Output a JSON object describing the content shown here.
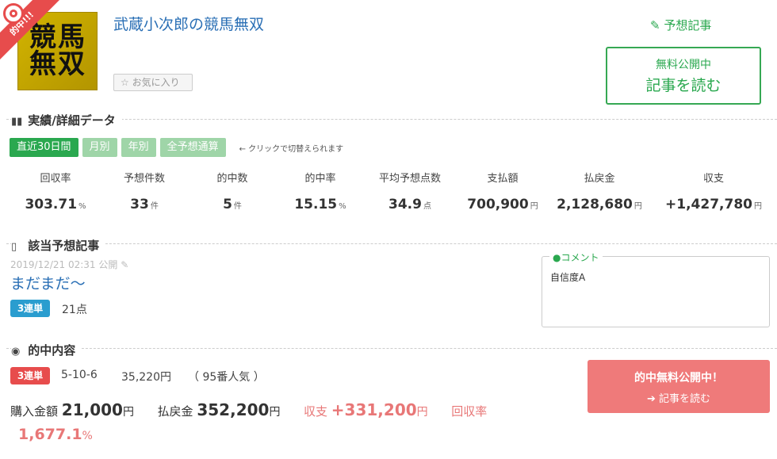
{
  "header": {
    "ribbon": "的中!!!",
    "avatar_text": "競馬\n無双",
    "title": "武蔵小次郎の競馬無双",
    "favorite_label": "お気に入り",
    "yoso_link": "予想記事",
    "read_box": {
      "sub": "無料公開中",
      "main": "記事を読む"
    }
  },
  "stats_section": {
    "heading": "実績/詳細データ",
    "tabs": [
      "直近30日間",
      "月別",
      "年別",
      "全予想通算"
    ],
    "tab_hint": "← クリックで切替えられます",
    "stats": [
      {
        "label": "回収率",
        "value": "303.71",
        "unit": "%"
      },
      {
        "label": "予想件数",
        "value": "33",
        "unit": "件"
      },
      {
        "label": "的中数",
        "value": "5",
        "unit": "件"
      },
      {
        "label": "的中率",
        "value": "15.15",
        "unit": "%"
      },
      {
        "label": "平均予想点数",
        "value": "34.9",
        "unit": "点"
      },
      {
        "label": "支払額",
        "value": "700,900",
        "unit": "円"
      },
      {
        "label": "払戻金",
        "value": "2,128,680",
        "unit": "円"
      },
      {
        "label": "収支",
        "value": "+1,427,780",
        "unit": "円"
      }
    ]
  },
  "article_section": {
    "heading": "該当予想記事",
    "date": "2019/12/21 02:31 公開",
    "title": "まだまだ〜",
    "bet_type": "3連単",
    "points": "21点",
    "comment_label": "コメント",
    "comment_text": "自信度A"
  },
  "hit_section": {
    "heading": "的中内容",
    "bet_type": "3連単",
    "combo": "5-10-6",
    "payout": "35,220円",
    "popularity": "（ 95番人気 ）",
    "purchase_label": "購入金額",
    "purchase_value": "21,000",
    "refund_label": "払戻金",
    "refund_value": "352,200",
    "balance_label": "収支",
    "balance_value": "+331,200",
    "rate_label": "回収率",
    "rate_value": "1,677.1",
    "rate_unit": "%",
    "yen": "円",
    "button_l1": "的中無料公開中！",
    "button_l2": "記事を読む"
  }
}
